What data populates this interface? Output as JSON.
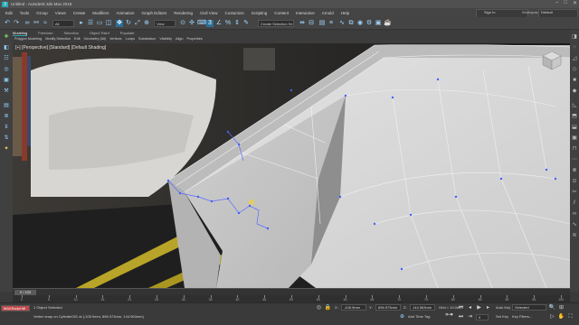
{
  "window": {
    "title": "Untitled - Autodesk 3ds Max 2018",
    "logo": "3",
    "controls": [
      "–",
      "□",
      "✕"
    ]
  },
  "menu": {
    "items": [
      "Edit",
      "Tools",
      "Group",
      "Views",
      "Create",
      "Modifiers",
      "Animation",
      "Graph Editors",
      "Rendering",
      "Civil View",
      "Customize",
      "Scripting",
      "Content",
      "Interactive",
      "Arnold",
      "Help"
    ],
    "sign_in": "Sign In",
    "workspaces_label": "Workspaces:",
    "workspace_value": "Default"
  },
  "toolbar": {
    "filter_value": "All",
    "view_value": "View",
    "selection_set": "Create Selection Se"
  },
  "ribbon": {
    "tabs": [
      "Modeling",
      "Freeform",
      "Selection",
      "Object Paint",
      "Populate"
    ],
    "subtabs": [
      "Polygon Modeling",
      "Modify Selection",
      "Edit",
      "Geometry (All)",
      "Vertices",
      "Loops",
      "Subdivision",
      "Visibility",
      "Align",
      "Properties"
    ]
  },
  "viewport": {
    "label": "[+] [Perspective] [Standard] [Default Shading]"
  },
  "timeline": {
    "frame_display": "0 / 100",
    "ticks": [
      "0",
      "5",
      "10",
      "15",
      "20",
      "25",
      "30",
      "35",
      "40",
      "45",
      "50",
      "55",
      "60",
      "65",
      "70",
      "75",
      "80",
      "85",
      "90",
      "95",
      "100"
    ],
    "current_fraction": 0.0
  },
  "status": {
    "maxscript": "MAXScript Mi",
    "selection": "1 Object Selected",
    "prompt": "Vertex snap on Cylinder001 at [-105.9mm, 896.973mm, 144.963mm]",
    "x_label": "X:",
    "x_value": "-105.9mm",
    "y_label": "Y:",
    "y_value": "896.973mm",
    "z_label": "Z:",
    "z_value": "144.963mm",
    "grid": "Grid = 10.0mm",
    "add_time_tag": "Add Time Tag",
    "auto_key": "Auto Key",
    "auto_key_value": "Selected",
    "set_key": "Set Key",
    "key_filters": "Key Filters...",
    "frame_value": "0"
  }
}
